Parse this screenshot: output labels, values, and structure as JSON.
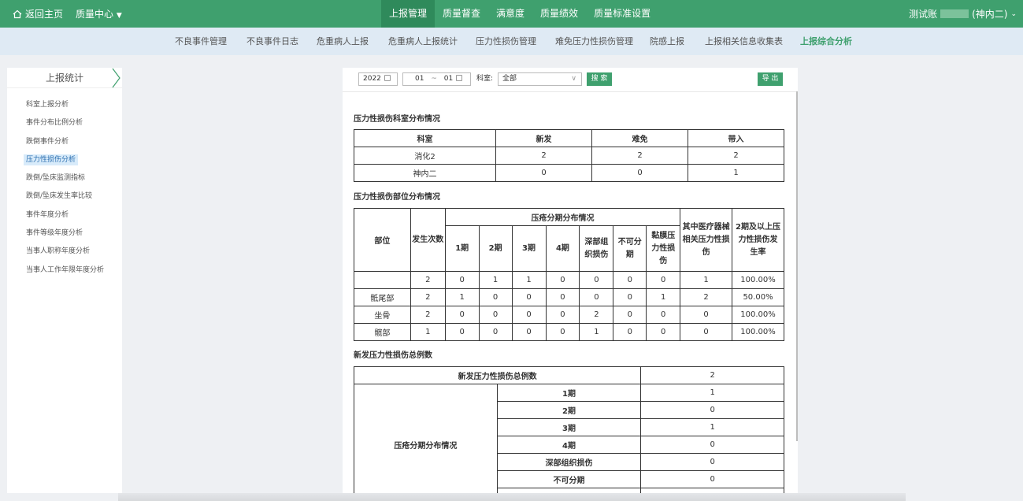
{
  "topbar": {
    "home_label": "返回主页",
    "quality_center": "质量中心",
    "nav": [
      "上报管理",
      "质量督查",
      "满意度",
      "质量绩效",
      "质量标准设置"
    ],
    "active_nav": 0,
    "user_prefix": "测试账",
    "user_dept": "(神内二)"
  },
  "subnav": {
    "items": [
      "不良事件管理",
      "不良事件日志",
      "危重病人上报",
      "危重病人上报统计",
      "压力性损伤管理",
      "难免压力性损伤管理",
      "院感上报",
      "上报相关信息收集表",
      "上报综合分析"
    ],
    "active": 8
  },
  "sidebar": {
    "title": "上报统计",
    "items": [
      "科室上报分析",
      "事件分布比例分析",
      "跌倒事件分析",
      "压力性损伤分析",
      "跌倒/坠床监测指标",
      "跌倒/坠床发生率比较",
      "事件年度分析",
      "事件等级年度分析",
      "当事人职称年度分析",
      "当事人工作年限年度分析"
    ],
    "active": 3
  },
  "toolbar": {
    "year": "2022",
    "month_start": "01",
    "tilde": "~",
    "month_end": "01",
    "dept_label": "科室:",
    "dept_value": "全部",
    "search_label": "搜 索",
    "export_label": "导 出"
  },
  "section1": {
    "title": "压力性损伤科室分布情况",
    "headers": [
      "科室",
      "新发",
      "难免",
      "带入"
    ],
    "rows": [
      [
        "消化2",
        "2",
        "2",
        "2"
      ],
      [
        "神内二",
        "0",
        "0",
        "1"
      ]
    ]
  },
  "section2": {
    "title": "压力性损伤部位分布情况",
    "h_part": "部位",
    "h_count": "发生次数",
    "h_group": "压疮分期分布情况",
    "h_stages": [
      "1期",
      "2期",
      "3期",
      "4期",
      "深部组织损伤",
      "不可分期",
      "黏膜压力性损伤"
    ],
    "h_device": "其中医疗器械相关压力性损伤",
    "h_rate": "2期及以上压力性损伤发生率",
    "rows": [
      [
        "",
        "2",
        "0",
        "1",
        "1",
        "0",
        "0",
        "0",
        "0",
        "1",
        "100.00%"
      ],
      [
        "骶尾部",
        "2",
        "1",
        "0",
        "0",
        "0",
        "0",
        "0",
        "1",
        "2",
        "50.00%"
      ],
      [
        "坐骨",
        "2",
        "0",
        "0",
        "0",
        "0",
        "2",
        "0",
        "0",
        "0",
        "100.00%"
      ],
      [
        "髋部",
        "1",
        "0",
        "0",
        "0",
        "0",
        "1",
        "0",
        "0",
        "0",
        "100.00%"
      ]
    ]
  },
  "section3": {
    "title": "新发压力性损伤总例数",
    "total_label": "新发压力性损伤总例数",
    "total_value": "2",
    "group_label": "压疮分期分布情况",
    "rows": [
      [
        "1期",
        "1"
      ],
      [
        "2期",
        "0"
      ],
      [
        "3期",
        "1"
      ],
      [
        "4期",
        "0"
      ],
      [
        "深部组织损伤",
        "0"
      ],
      [
        "不可分期",
        "0"
      ]
    ]
  },
  "colors": {
    "brand": "#3fa06e",
    "subnav_bg": "#dfeaf4"
  }
}
